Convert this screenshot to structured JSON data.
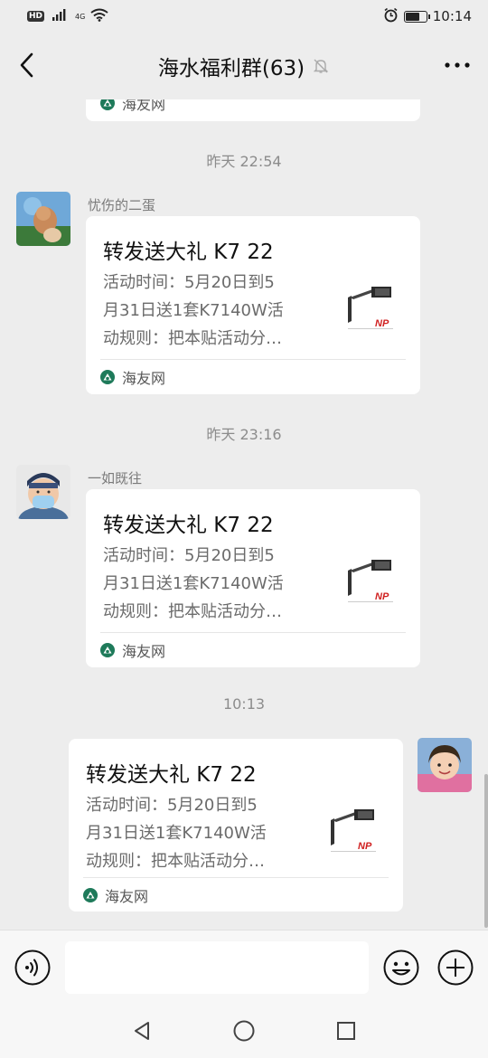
{
  "status_bar": {
    "hd": "HD",
    "network": "4G",
    "time": "10:14",
    "battery_level": 0.7
  },
  "header": {
    "title": "海水福利群(63)",
    "icons": {
      "back": "chevron-left-icon",
      "mute": "bell-muted-icon",
      "more": "more-dots-icon"
    }
  },
  "messages": {
    "top_partial": {
      "source": "海友网"
    },
    "groups": [
      {
        "timestamp": "昨天 22:54",
        "sender": "忧伤的二蛋",
        "card": {
          "title": "转发送大礼 K7 22",
          "desc_lines": [
            "活动时间：5月20日到5",
            "月31日送1套K7140W活",
            "动规则：把本贴活动分…"
          ],
          "source": "海友网"
        }
      },
      {
        "timestamp": "昨天 23:16",
        "sender": "一如既往",
        "card": {
          "title": "转发送大礼 K7 22",
          "desc_lines": [
            "活动时间：5月20日到5",
            "月31日送1套K7140W活",
            "动规则：把本贴活动分…"
          ],
          "source": "海友网"
        }
      },
      {
        "timestamp": "10:13",
        "sender": "",
        "card": {
          "title": "转发送大礼 K7 22",
          "desc_lines": [
            "活动时间：5月20日到5",
            "月31日送1套K7140W活",
            "动规则：把本贴活动分…"
          ],
          "source": "海友网"
        }
      }
    ],
    "thumb_brand": "NP"
  },
  "input_bar": {
    "placeholder": "",
    "icons": {
      "voice": "voice-icon",
      "emoji": "emoji-icon",
      "plus": "plus-circle-icon"
    }
  },
  "nav_bar": {
    "icons": {
      "back": "triangle-back-icon",
      "home": "circle-home-icon",
      "recents": "square-recents-icon"
    }
  },
  "colors": {
    "background": "#ededed",
    "card": "#ffffff",
    "source_icon": "#1e7a5a",
    "brand_red": "#d02020"
  }
}
